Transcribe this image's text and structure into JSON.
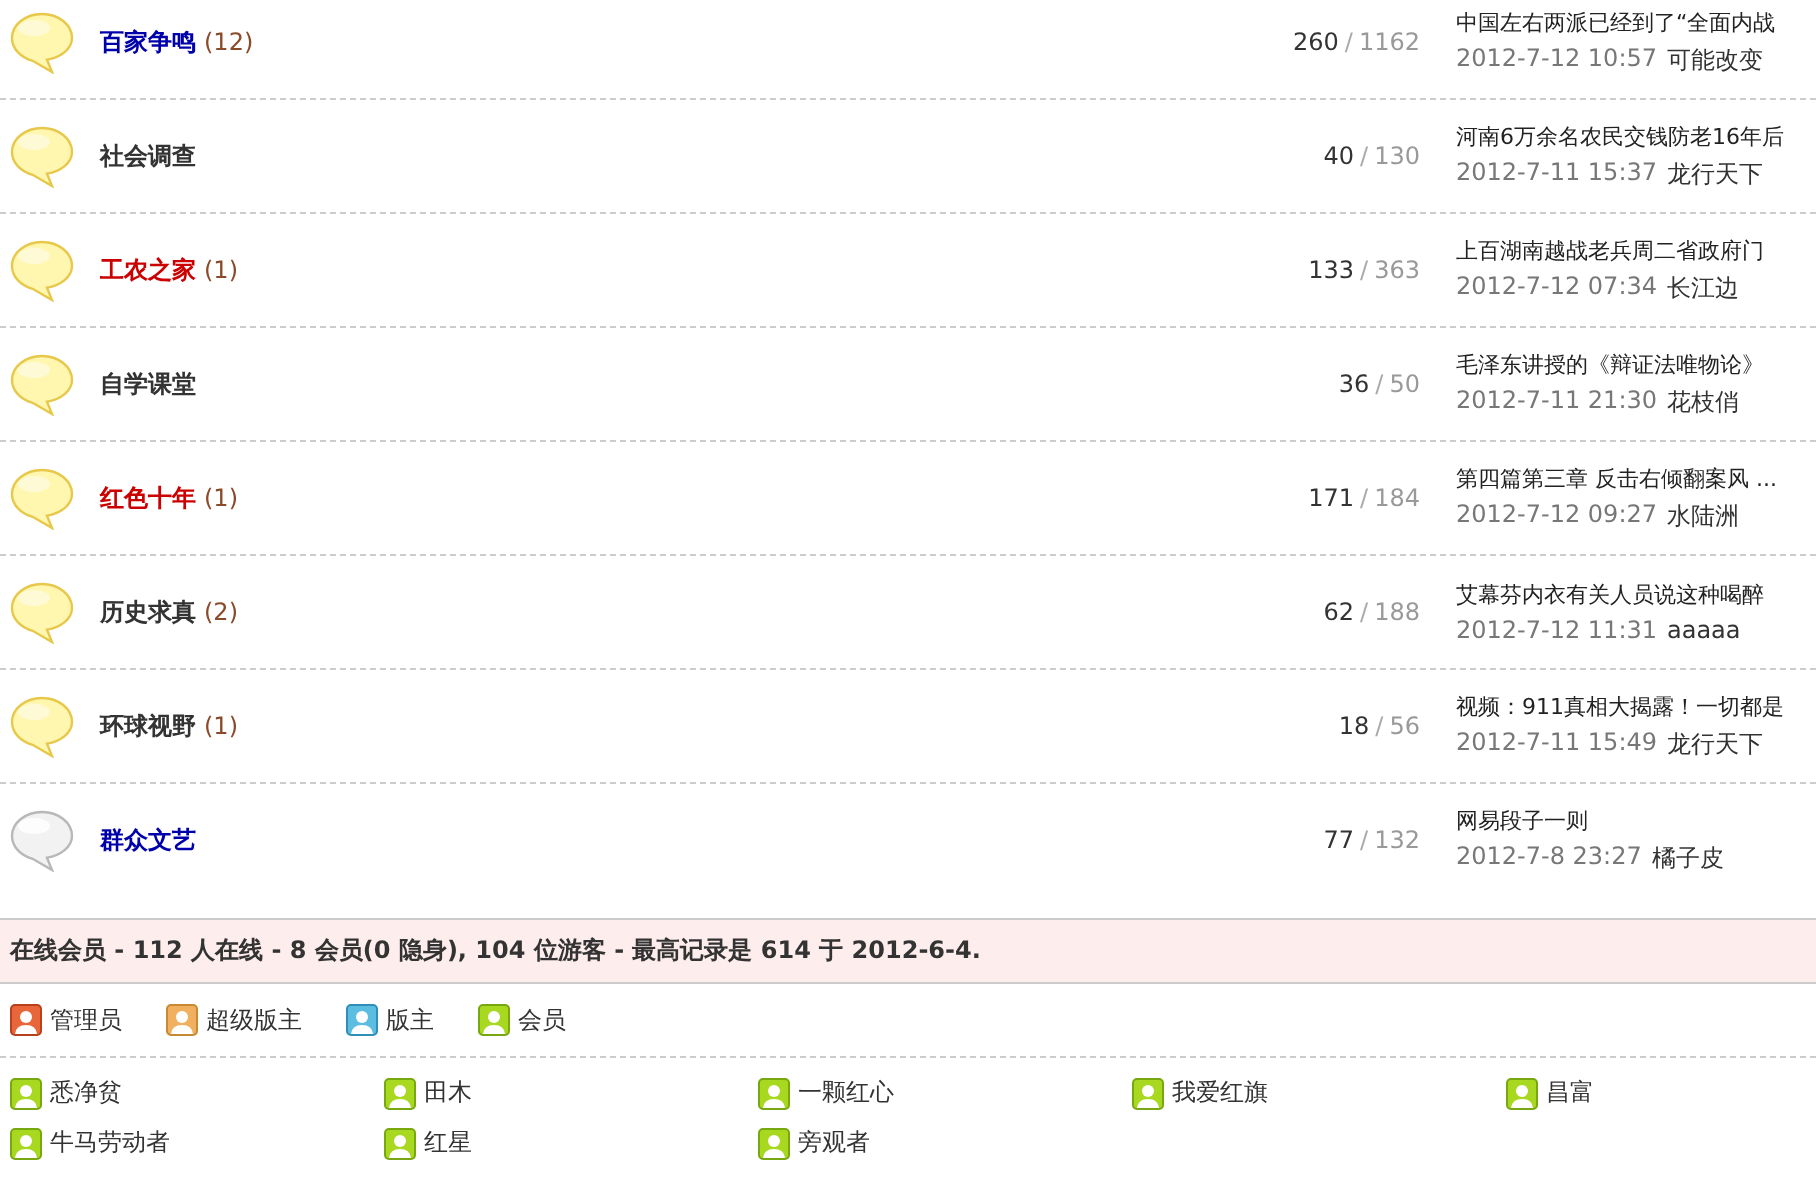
{
  "forums": [
    {
      "name": "百家争鸣",
      "color": "#0000aa",
      "today": "(12)",
      "new": true,
      "threads": "260",
      "slash": "/",
      "posts": "1162",
      "last_title": "中国左右两派已经到了“全面内战",
      "last_time": "2012-7-12 10:57",
      "last_author": "可能改变"
    },
    {
      "name": "社会调查",
      "color": "#333333",
      "new": true,
      "threads": "40",
      "slash": "/",
      "posts": "130",
      "last_title": "河南6万余名农民交钱防老16年后",
      "last_time": "2012-7-11 15:37",
      "last_author": "龙行天下"
    },
    {
      "name": "工农之家",
      "color": "#cc0000",
      "today": "(1)",
      "new": true,
      "threads": "133",
      "slash": "/",
      "posts": "363",
      "last_title": "上百湖南越战老兵周二省政府门",
      "last_time": "2012-7-12 07:34",
      "last_author": "长江边"
    },
    {
      "name": "自学课堂",
      "color": "#333333",
      "new": true,
      "threads": "36",
      "slash": "/",
      "posts": "50",
      "last_title": "毛泽东讲授的《辩证法唯物论》",
      "last_time": "2012-7-11 21:30",
      "last_author": "花枝俏"
    },
    {
      "name": "红色十年",
      "color": "#cc0000",
      "today": "(1)",
      "new": true,
      "threads": "171",
      "slash": "/",
      "posts": "184",
      "last_title": "第四篇第三章 反击右倾翻案风 ...",
      "last_time": "2012-7-12 09:27",
      "last_author": "水陆洲"
    },
    {
      "name": "历史求真",
      "color": "#333333",
      "today": "(2)",
      "new": true,
      "threads": "62",
      "slash": "/",
      "posts": "188",
      "last_title": "艾幕芬内衣有关人员说这种喝醉",
      "last_time": "2012-7-12 11:31",
      "last_author": "aaaaa"
    },
    {
      "name": "环球视野",
      "color": "#333333",
      "today": "(1)",
      "new": true,
      "threads": "18",
      "slash": "/",
      "posts": "56",
      "last_title": "视频：911真相大揭露！一切都是",
      "last_time": "2012-7-11 15:49",
      "last_author": "龙行天下"
    },
    {
      "name": "群众文艺",
      "color": "#0000aa",
      "new": false,
      "threads": "77",
      "slash": "/",
      "posts": "132",
      "last_title": "网易段子一则",
      "last_time": "2012-7-8 23:27",
      "last_author": "橘子皮"
    }
  ],
  "online": {
    "title": "在线会员 - 112 人在线 - 8 会员(0 隐身), 104 位游客 - 最高记录是 614 于 2012-6-4.",
    "legend": [
      {
        "kind": "admin",
        "label": "管理员"
      },
      {
        "kind": "supermod",
        "label": "超级版主"
      },
      {
        "kind": "mod",
        "label": "版主"
      },
      {
        "kind": "member",
        "label": "会员"
      }
    ],
    "users": [
      {
        "kind": "member",
        "name": "悉净贫"
      },
      {
        "kind": "member",
        "name": "田木"
      },
      {
        "kind": "member",
        "name": "一颗红心"
      },
      {
        "kind": "member",
        "name": "我爱红旗"
      },
      {
        "kind": "member",
        "name": "昌富"
      },
      {
        "kind": "member",
        "name": "牛马劳动者"
      },
      {
        "kind": "member",
        "name": "红星"
      },
      {
        "kind": "member",
        "name": "旁观者"
      }
    ]
  }
}
